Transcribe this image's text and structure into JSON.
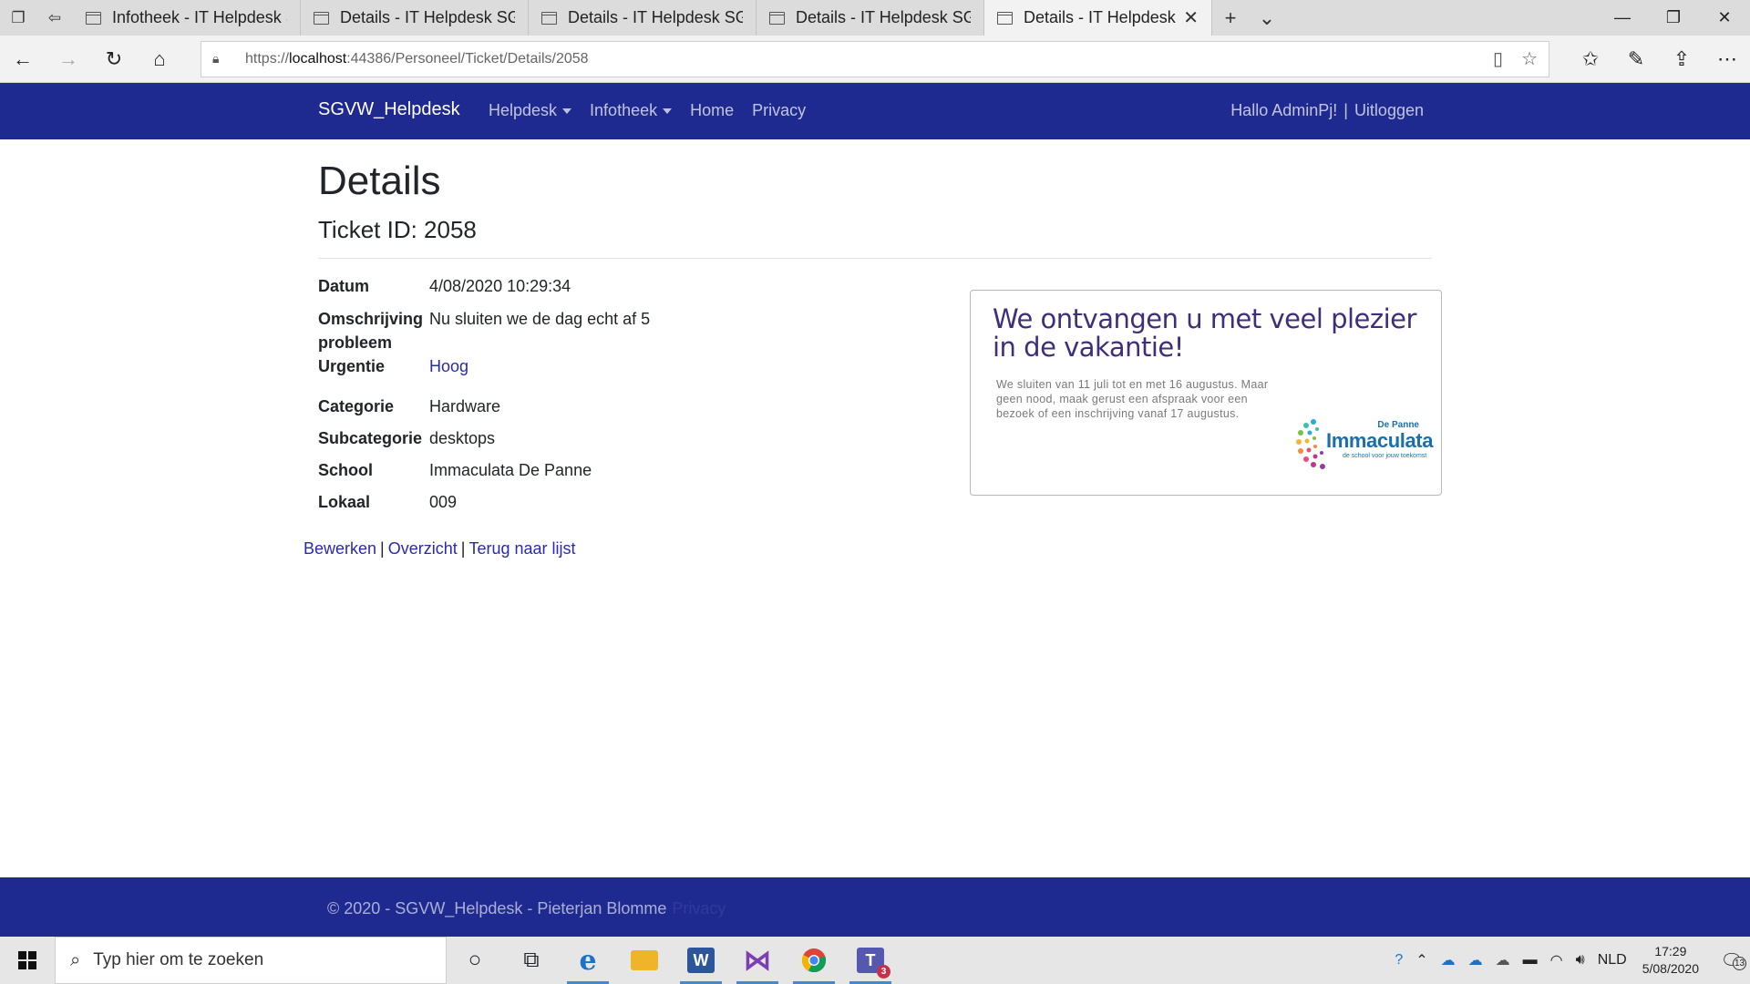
{
  "browser": {
    "tabs": [
      {
        "title": "Infotheek - IT Helpdesk SGVW",
        "active": false
      },
      {
        "title": "Details - IT Helpdesk SGVW",
        "active": false
      },
      {
        "title": "Details - IT Helpdesk SGVW",
        "active": false
      },
      {
        "title": "Details - IT Helpdesk SGVW",
        "active": false
      },
      {
        "title": "Details - IT Helpdesk SGVW",
        "active": true
      }
    ],
    "url_scheme": "https://",
    "url_host": "localhost",
    "url_rest": ":44386/Personeel/Ticket/Details/2058"
  },
  "nav": {
    "brand": "SGVW_Helpdesk",
    "helpdesk": "Helpdesk",
    "infotheek": "Infotheek",
    "home": "Home",
    "privacy": "Privacy",
    "greeting": "Hallo AdminPj!",
    "separator": "|",
    "logout": "Uitloggen"
  },
  "page": {
    "title": "Details",
    "ticket_id": "Ticket ID: 2058"
  },
  "details": [
    {
      "label": "Datum",
      "value": "4/08/2020 10:29:34"
    },
    {
      "label": "Omschrijving probleem",
      "value": "Nu sluiten we de dag echt af 5"
    },
    {
      "label": "Urgentie",
      "value": "Hoog"
    },
    {
      "label": "Categorie",
      "value": "Hardware"
    },
    {
      "label": "Subcategorie",
      "value": "desktops"
    },
    {
      "label": "School",
      "value": "Immaculata De Panne"
    },
    {
      "label": "Lokaal",
      "value": "009"
    }
  ],
  "poster": {
    "heading": "We ontvangen u met veel plezier in de vakantie!",
    "body": "We sluiten van 11 juli tot en met 16 augustus. Maar geen nood, maak gerust een afspraak voor een bezoek of een inschrijving vanaf 17 augustus.",
    "logo_top": "De Panne",
    "logo_name": "Immaculata",
    "logo_sub": "de school voor jouw toekomst"
  },
  "actions": {
    "edit": "Bewerken",
    "overview": "Overzicht",
    "back": "Terug naar lijst",
    "separator": "|"
  },
  "footer": {
    "text": "© 2020 - SGVW_Helpdesk - Pieterjan Blomme",
    "privacy": "Privacy"
  },
  "taskbar": {
    "search_placeholder": "Typ hier om te zoeken",
    "language": "NLD",
    "time": "17:29",
    "date": "5/08/2020",
    "notification_count": "13",
    "teams_badge": "3"
  }
}
